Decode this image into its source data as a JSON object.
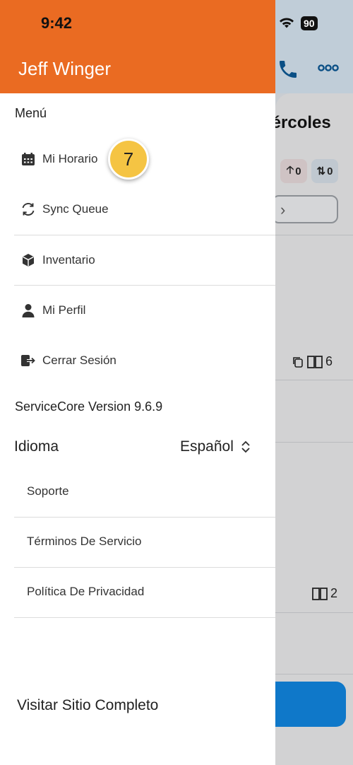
{
  "status_bar": {
    "time": "9:42",
    "battery": "90"
  },
  "drawer": {
    "user_name": "Jeff Winger",
    "menu_heading": "Menú",
    "items": [
      {
        "label": "Mi Horario",
        "icon": "calendar-icon"
      },
      {
        "label": "Sync Queue",
        "icon": "sync-icon"
      },
      {
        "label": "Inventario",
        "icon": "box-icon"
      },
      {
        "label": "Mi Perfil",
        "icon": "user-icon"
      },
      {
        "label": "Cerrar Sesión",
        "icon": "logout-icon"
      }
    ],
    "badge": "7",
    "version": "ServiceCore Version 9.6.9",
    "language": {
      "label": "Idioma",
      "value": "Español"
    },
    "links": [
      "Soporte",
      "Términos De Servicio",
      "Política De Privacidad"
    ],
    "visit_site": "Visitar Sitio Completo"
  },
  "background": {
    "day_fragment": "iércoles",
    "chip_up": "0",
    "chip_sync": "0",
    "row_count_a": "6",
    "row_count_b": "2"
  },
  "colors": {
    "header": "#ea6b22",
    "badge": "#f5c443",
    "accent_blue": "#0f78c9"
  }
}
